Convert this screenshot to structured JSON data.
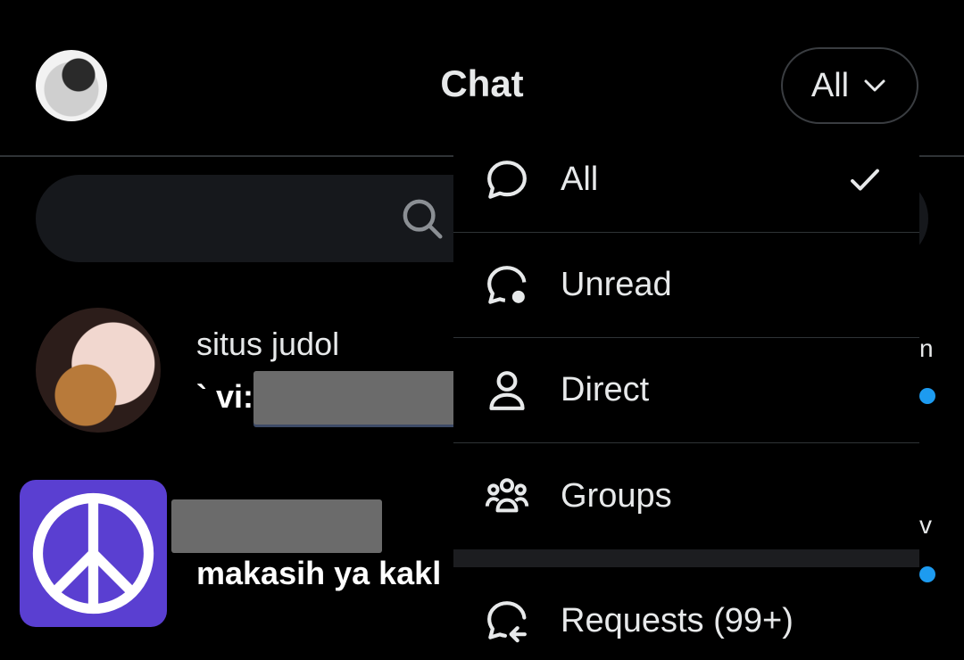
{
  "header": {
    "title": "Chat",
    "filter_label": "All"
  },
  "conversations": [
    {
      "name": "situs judol",
      "message_prefix": "` vi:"
    },
    {
      "message": "makasih ya kakl"
    }
  ],
  "right_edge": {
    "row1_char": "n",
    "row2_char": "v"
  },
  "menu": {
    "items": [
      {
        "label": "All",
        "selected": true,
        "icon": "chat-bubble-icon"
      },
      {
        "label": "Unread",
        "icon": "chat-bubble-unread-icon"
      },
      {
        "label": "Direct",
        "icon": "person-icon"
      },
      {
        "label": "Groups",
        "icon": "group-icon"
      }
    ],
    "requests": {
      "label": "Requests (99+)",
      "icon": "chat-bubble-request-icon"
    }
  },
  "colors": {
    "background": "#000000",
    "accent_blue": "#1d9bf0",
    "text": "#e7e9ea",
    "avatar_purple": "#5a3fd1"
  }
}
